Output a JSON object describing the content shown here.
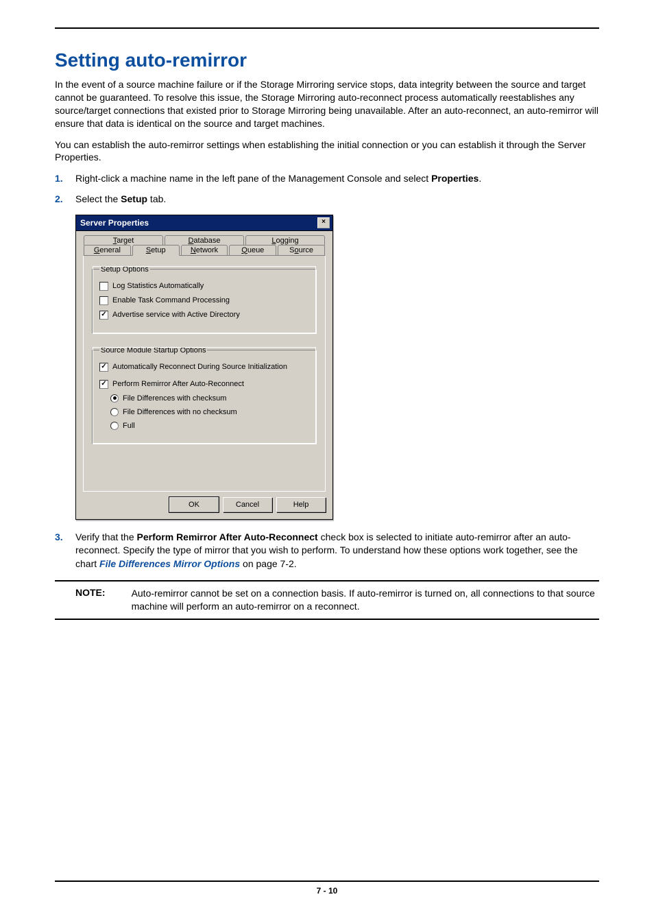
{
  "heading": "Setting auto-remirror",
  "para1": "In the event of a source machine failure or if the Storage Mirroring service stops, data integrity between the source and target cannot be guaranteed. To resolve this issue, the Storage Mirroring auto-reconnect process automatically reestablishes any source/target connections that existed prior to Storage Mirroring being unavailable. After an auto-reconnect, an auto-remirror will ensure that data is identical on the source and target machines.",
  "para2": "You can establish the auto-remirror settings when establishing the initial connection or you can establish it through the Server Properties.",
  "steps": {
    "s1_num": "1.",
    "s1_a": "Right-click a machine name in the left pane of the Management Console and select ",
    "s1_b": "Properties",
    "s1_c": ".",
    "s2_num": "2.",
    "s2_a": "Select the ",
    "s2_b": "Setup",
    "s2_c": " tab.",
    "s3_num": "3.",
    "s3_a": "Verify that the ",
    "s3_b": "Perform Remirror After Auto-Reconnect",
    "s3_c": " check box is selected to initiate auto-remirror after an auto-reconnect. Specify the type of mirror that you wish to perform. To understand how these options work together, see the chart ",
    "s3_link": "File Differences Mirror Options",
    "s3_d": " on page 7-2."
  },
  "dialog": {
    "title": "Server Properties",
    "close": "×",
    "tabs_back": {
      "target": "Target",
      "database": "Database",
      "logging": "Logging"
    },
    "tabs_front": {
      "general": "General",
      "setup": "Setup",
      "network": "Network",
      "queue": "Queue",
      "source": "Source"
    },
    "group1": {
      "legend": "Setup Options",
      "opt1": "Log Statistics Automatically",
      "opt2": "Enable Task Command Processing",
      "opt3": "Advertise service with Active Directory"
    },
    "group2": {
      "legend": "Source Module Startup Options",
      "opt1": "Automatically Reconnect During Source Initialization",
      "opt2": "Perform Remirror After Auto-Reconnect",
      "r1": "File Differences with checksum",
      "r2": "File Differences with no checksum",
      "r3": "Full"
    },
    "buttons": {
      "ok": "OK",
      "cancel": "Cancel",
      "help": "Help"
    }
  },
  "note": {
    "label": "NOTE:",
    "text": "Auto-remirror cannot be set on a connection basis. If auto-remirror is turned on, all connections to that source machine will perform an auto-remirror on a reconnect."
  },
  "page_number": "7 - 10"
}
